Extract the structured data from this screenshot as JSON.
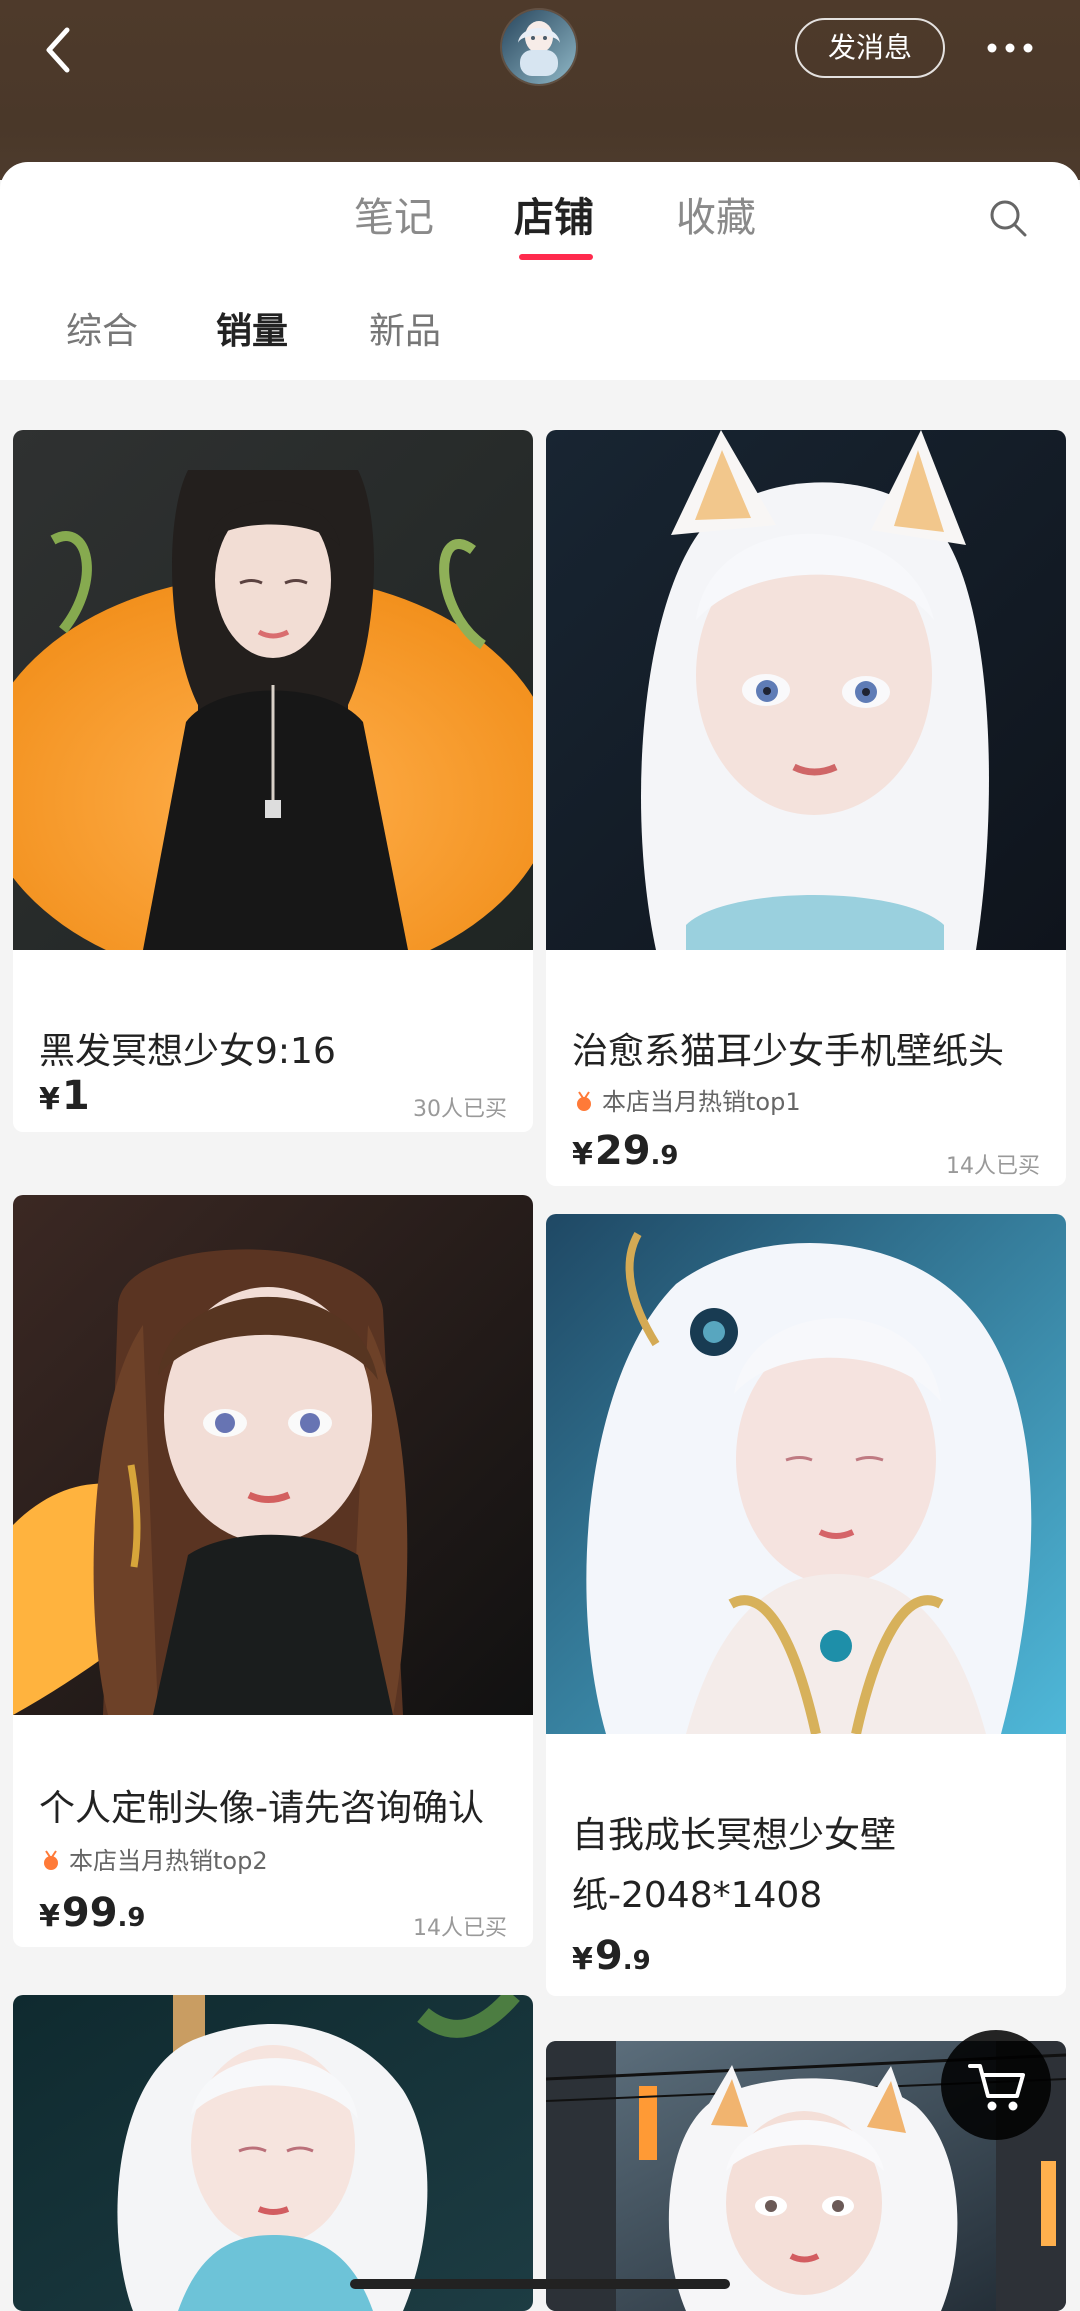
{
  "topbar": {
    "back_icon": "chevron-left-icon",
    "avatar_label": "",
    "message_button": "发消息",
    "more_icon": "more-horizontal-icon"
  },
  "tabs": {
    "notes": "笔记",
    "store": "店铺",
    "favorites": "收藏",
    "search_icon": "search-icon"
  },
  "filters": {
    "all": "综合",
    "sales": "销量",
    "new": "新品"
  },
  "cards": [
    {
      "title": "黑发冥想少女9:16",
      "price_currency": "¥",
      "price_int": "1",
      "price_dec": "",
      "sold": "30人已买"
    },
    {
      "title": "治愈系猫耳少女手机壁纸头",
      "rank": "本店当月热销top1",
      "price_currency": "¥",
      "price_int": "29",
      "price_dec": ".9",
      "sold": "14人已买"
    },
    {
      "title": "个人定制头像-请先咨询确认",
      "rank": "本店当月热销top2",
      "price_currency": "¥",
      "price_int": "99",
      "price_dec": ".9",
      "sold": "14人已买"
    },
    {
      "title_line1": "自我成长冥想少女壁",
      "title_line2": "纸-2048*1408",
      "price_currency": "¥",
      "price_int": "9",
      "price_dec": ".9"
    }
  ],
  "floating_cart": {
    "icon": "shopping-cart-icon"
  },
  "colors": {
    "accent": "#ff2a4d",
    "header_bg": "#4a3829",
    "card_bg": "#ffffff",
    "page_bg": "#f4f4f4"
  }
}
